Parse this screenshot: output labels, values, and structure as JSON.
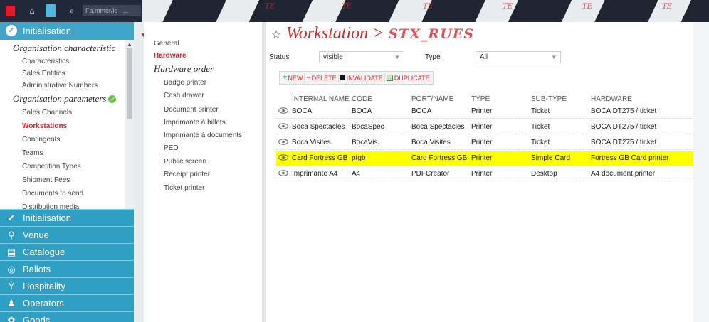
{
  "topbar": {
    "search_text": "Fa.mmer/ic - ...",
    "watermark": "TE"
  },
  "sidebar": {
    "open_section": "Initialisation",
    "groups": [
      {
        "title": "Organisation characteristic",
        "items": [
          "Characteristics",
          "Sales Entities",
          "Administrative Numbers"
        ]
      },
      {
        "title": "Organisation parameters",
        "items": [
          "Sales Channels",
          "Workstations",
          "Contingents",
          "Teams",
          "Competition Types",
          "Shipment Fees",
          "Documents to send",
          "Distribution media"
        ]
      }
    ],
    "nav": [
      "Initialisation",
      "Venue",
      "Catalogue",
      "Ballots",
      "Hospitality",
      "Operators",
      "Goods"
    ]
  },
  "midmenu": {
    "general": "General",
    "hardware": "Hardware",
    "section_title": "Hardware order",
    "items": [
      "Badge printer",
      "Cash drawer",
      "Document printer",
      "Imprimante à billets",
      "Imprimante à documents",
      "PED",
      "Public screen",
      "Receipt printer",
      "Ticket printer"
    ]
  },
  "main": {
    "title_prefix": "Workstation > ",
    "title_name": "STX_RUES",
    "filters": {
      "status_label": "Status",
      "status_value": "visible",
      "type_label": "Type",
      "type_value": "All"
    },
    "buttons": {
      "new": "NEW",
      "delete": "DELETE",
      "invalidate": "INVALIDATE",
      "duplicate": "DUPLICATE"
    },
    "columns": [
      "INTERNAL NAME",
      "CODE",
      "PORT/NAME",
      "TYPE",
      "SUB-TYPE",
      "HARDWARE"
    ],
    "rows": [
      {
        "name": "BOCA",
        "code": "BOCA",
        "port": "BOCA",
        "type": "Printer",
        "subtype": "Ticket",
        "hardware": "BOCA DT275 / ticket",
        "highlighted": false
      },
      {
        "name": "Boca Spectacles",
        "code": "BocaSpec",
        "port": "Boca Spectacles",
        "type": "Printer",
        "subtype": "Ticket",
        "hardware": "BOCA DT275 / ticket",
        "highlighted": false
      },
      {
        "name": "Boca Visites",
        "code": "BocaVis",
        "port": "Boca Visites",
        "type": "Printer",
        "subtype": "Ticket",
        "hardware": "BOCA DT275 / ticket",
        "highlighted": false
      },
      {
        "name": "Card Fortress GB",
        "code": "pfgb",
        "port": "Card Fortress GB",
        "type": "Printer",
        "subtype": "Simple Card",
        "hardware": "Fortress GB Card printer",
        "highlighted": true
      },
      {
        "name": "Imprimante A4",
        "code": "A4",
        "port": "PDFCreator",
        "type": "Printer",
        "subtype": "Desktop",
        "hardware": "A4 document printer",
        "highlighted": false
      }
    ]
  },
  "colors": {
    "accent_red": "#d9232b",
    "sidebar_blue": "#2f9fc4",
    "highlight": "#ffff00"
  }
}
